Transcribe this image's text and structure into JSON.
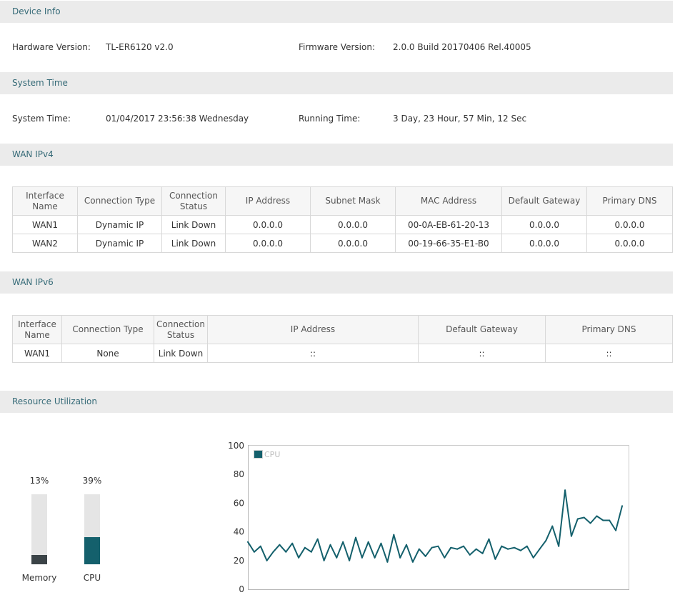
{
  "device_info": {
    "title": "Device Info",
    "hardware_version_label": "Hardware Version:",
    "hardware_version": "TL-ER6120 v2.0",
    "firmware_version_label": "Firmware Version:",
    "firmware_version": "2.0.0 Build 20170406 Rel.40005"
  },
  "system_time": {
    "title": "System Time",
    "system_time_label": "System Time:",
    "system_time": "01/04/2017 23:56:38 Wednesday",
    "running_time_label": "Running Time:",
    "running_time": "3 Day, 23 Hour, 57 Min, 12 Sec"
  },
  "wan_ipv4": {
    "title": "WAN IPv4",
    "columns": [
      "Interface Name",
      "Connection Type",
      "Connection Status",
      "IP Address",
      "Subnet Mask",
      "MAC Address",
      "Default Gateway",
      "Primary DNS"
    ],
    "rows": [
      [
        "WAN1",
        "Dynamic IP",
        "Link Down",
        "0.0.0.0",
        "0.0.0.0",
        "00-0A-EB-61-20-13",
        "0.0.0.0",
        "0.0.0.0"
      ],
      [
        "WAN2",
        "Dynamic IP",
        "Link Down",
        "0.0.0.0",
        "0.0.0.0",
        "00-19-66-35-E1-B0",
        "0.0.0.0",
        "0.0.0.0"
      ]
    ]
  },
  "wan_ipv6": {
    "title": "WAN IPv6",
    "columns": [
      "Interface Name",
      "Connection Type",
      "Connection Status",
      "IP Address",
      "Default Gateway",
      "Primary DNS"
    ],
    "rows": [
      [
        "WAN1",
        "None",
        "Link Down",
        "::",
        "::",
        "::"
      ]
    ]
  },
  "resource": {
    "title": "Resource Utilization",
    "memory": {
      "label": "Memory",
      "percent": "13%",
      "value": 13
    },
    "cpu": {
      "label": "CPU",
      "percent": "39%",
      "value": 39
    }
  },
  "colors": {
    "section_title": "#356a77",
    "section_bar": "#ebebeb",
    "memory": "#3b4347",
    "cpu": "#14606c",
    "usage_track": "#e5e5e5"
  },
  "chart_data": {
    "type": "line",
    "ylim": [
      0,
      100
    ],
    "yticks": [
      0,
      20,
      40,
      60,
      80,
      100
    ],
    "grid": false,
    "legend": "top-left",
    "series": [
      {
        "name": "CPU",
        "values": [
          33,
          26,
          30,
          20,
          26,
          31,
          26,
          32,
          22,
          29,
          26,
          35,
          20,
          31,
          22,
          33,
          20,
          36,
          22,
          33,
          22,
          32,
          19,
          38,
          22,
          31,
          19,
          28,
          23,
          29,
          30,
          22,
          29,
          28,
          30,
          24,
          28,
          25,
          35,
          21,
          30,
          28,
          29,
          27,
          30,
          22,
          28,
          34,
          44,
          30,
          69,
          37,
          49,
          50,
          46,
          51,
          48,
          48,
          41,
          58
        ]
      }
    ]
  }
}
